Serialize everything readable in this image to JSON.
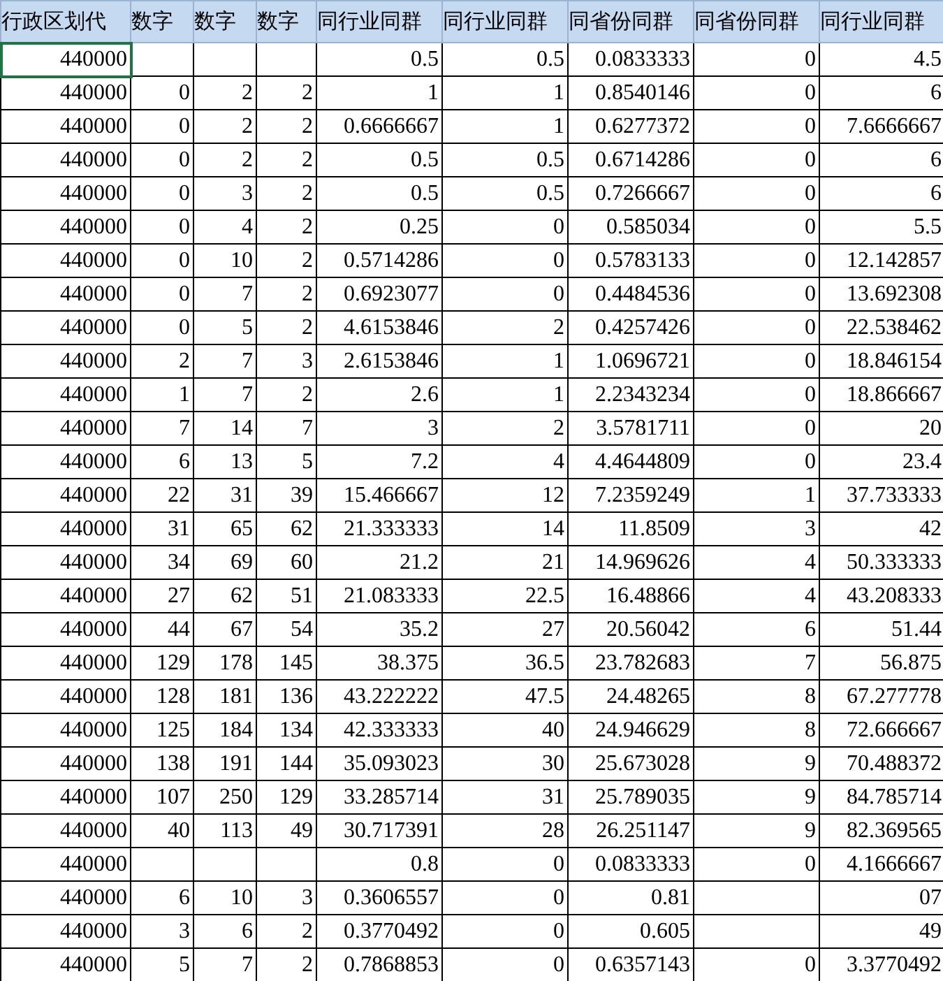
{
  "table": {
    "columns": [
      "行政区划代",
      "数字",
      "数字",
      "数字",
      "同行业同群",
      "同行业同群",
      "同省份同群",
      "同省份同群",
      "同行业同群"
    ],
    "rows": [
      {
        "selected": true,
        "cells": [
          "440000",
          "",
          "",
          "",
          "0.5",
          "0.5",
          "0.0833333",
          "0",
          "4.5"
        ]
      },
      {
        "selected": false,
        "cells": [
          "440000",
          "0",
          "2",
          "2",
          "1",
          "1",
          "0.8540146",
          "0",
          "6"
        ]
      },
      {
        "selected": false,
        "cells": [
          "440000",
          "0",
          "2",
          "2",
          "0.6666667",
          "1",
          "0.6277372",
          "0",
          "7.6666667"
        ]
      },
      {
        "selected": false,
        "cells": [
          "440000",
          "0",
          "2",
          "2",
          "0.5",
          "0.5",
          "0.6714286",
          "0",
          "6"
        ]
      },
      {
        "selected": false,
        "cells": [
          "440000",
          "0",
          "3",
          "2",
          "0.5",
          "0.5",
          "0.7266667",
          "0",
          "6"
        ]
      },
      {
        "selected": false,
        "cells": [
          "440000",
          "0",
          "4",
          "2",
          "0.25",
          "0",
          "0.585034",
          "0",
          "5.5"
        ]
      },
      {
        "selected": false,
        "cells": [
          "440000",
          "0",
          "10",
          "2",
          "0.5714286",
          "0",
          "0.5783133",
          "0",
          "12.142857"
        ]
      },
      {
        "selected": false,
        "cells": [
          "440000",
          "0",
          "7",
          "2",
          "0.6923077",
          "0",
          "0.4484536",
          "0",
          "13.692308"
        ]
      },
      {
        "selected": false,
        "cells": [
          "440000",
          "0",
          "5",
          "2",
          "4.6153846",
          "2",
          "0.4257426",
          "0",
          "22.538462"
        ]
      },
      {
        "selected": false,
        "cells": [
          "440000",
          "2",
          "7",
          "3",
          "2.6153846",
          "1",
          "1.0696721",
          "0",
          "18.846154"
        ]
      },
      {
        "selected": false,
        "cells": [
          "440000",
          "1",
          "7",
          "2",
          "2.6",
          "1",
          "2.2343234",
          "0",
          "18.866667"
        ]
      },
      {
        "selected": false,
        "cells": [
          "440000",
          "7",
          "14",
          "7",
          "3",
          "2",
          "3.5781711",
          "0",
          "20"
        ]
      },
      {
        "selected": false,
        "cells": [
          "440000",
          "6",
          "13",
          "5",
          "7.2",
          "4",
          "4.4644809",
          "0",
          "23.4"
        ]
      },
      {
        "selected": false,
        "cells": [
          "440000",
          "22",
          "31",
          "39",
          "15.466667",
          "12",
          "7.2359249",
          "1",
          "37.733333"
        ]
      },
      {
        "selected": false,
        "cells": [
          "440000",
          "31",
          "65",
          "62",
          "21.333333",
          "14",
          "11.8509",
          "3",
          "42"
        ]
      },
      {
        "selected": false,
        "cells": [
          "440000",
          "34",
          "69",
          "60",
          "21.2",
          "21",
          "14.969626",
          "4",
          "50.333333"
        ]
      },
      {
        "selected": false,
        "cells": [
          "440000",
          "27",
          "62",
          "51",
          "21.083333",
          "22.5",
          "16.48866",
          "4",
          "43.208333"
        ]
      },
      {
        "selected": false,
        "cells": [
          "440000",
          "44",
          "67",
          "54",
          "35.2",
          "27",
          "20.56042",
          "6",
          "51.44"
        ]
      },
      {
        "selected": false,
        "cells": [
          "440000",
          "129",
          "178",
          "145",
          "38.375",
          "36.5",
          "23.782683",
          "7",
          "56.875"
        ]
      },
      {
        "selected": false,
        "cells": [
          "440000",
          "128",
          "181",
          "136",
          "43.222222",
          "47.5",
          "24.48265",
          "8",
          "67.277778"
        ]
      },
      {
        "selected": false,
        "cells": [
          "440000",
          "125",
          "184",
          "134",
          "42.333333",
          "40",
          "24.946629",
          "8",
          "72.666667"
        ]
      },
      {
        "selected": false,
        "cells": [
          "440000",
          "138",
          "191",
          "144",
          "35.093023",
          "30",
          "25.673028",
          "9",
          "70.488372"
        ]
      },
      {
        "selected": false,
        "cells": [
          "440000",
          "107",
          "250",
          "129",
          "33.285714",
          "31",
          "25.789035",
          "9",
          "84.785714"
        ]
      },
      {
        "selected": false,
        "cells": [
          "440000",
          "40",
          "113",
          "49",
          "30.717391",
          "28",
          "26.251147",
          "9",
          "82.369565"
        ]
      },
      {
        "selected": false,
        "cells": [
          "440000",
          "",
          "",
          "",
          "0.8",
          "0",
          "0.0833333",
          "0",
          "4.1666667"
        ]
      },
      {
        "selected": false,
        "cells": [
          "440000",
          "6",
          "10",
          "3",
          "0.3606557",
          "0",
          "0.81",
          "",
          "07"
        ]
      },
      {
        "selected": false,
        "cells": [
          "440000",
          "3",
          "6",
          "2",
          "0.3770492",
          "0",
          "0.605",
          "",
          "49"
        ]
      },
      {
        "selected": false,
        "cells": [
          "440000",
          "5",
          "7",
          "2",
          "0.7868853",
          "0",
          "0.6357143",
          "0",
          "3.3770492"
        ]
      }
    ]
  }
}
